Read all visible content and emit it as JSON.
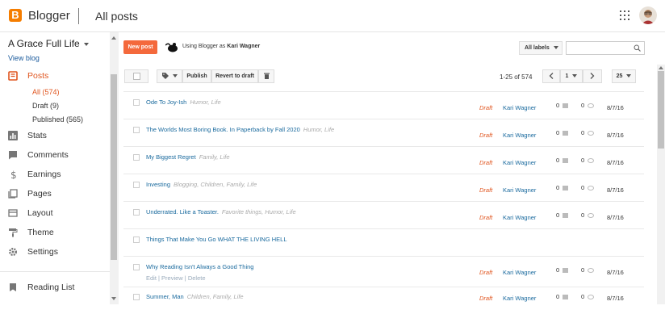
{
  "header": {
    "logo_letter": "B",
    "brand": "Blogger",
    "page_title": "All posts"
  },
  "sidebar": {
    "blog_name": "A Grace Full Life",
    "view_blog": "View blog",
    "posts_label": "Posts",
    "posts_sub": [
      "All (574)",
      "Draft (9)",
      "Published (565)"
    ],
    "items": [
      "Stats",
      "Comments",
      "Earnings",
      "Pages",
      "Layout",
      "Theme",
      "Settings"
    ],
    "reading_list": "Reading List"
  },
  "toolbar": {
    "new_post": "New post",
    "using_as_prefix": "Using Blogger as ",
    "user_name": "Kari Wagner",
    "all_labels": "All labels",
    "publish": "Publish",
    "revert": "Revert to draft",
    "page_info": "1-25 of 574",
    "page_number": "1",
    "page_size": "25"
  },
  "posts": [
    {
      "title": "Ode To Joy-Ish",
      "labels": "Humor, Life",
      "status": "Draft",
      "author": "Kari Wagner",
      "comments": "0",
      "views": "0",
      "date": "8/7/16"
    },
    {
      "title": "The Worlds Most Boring Book. In Paperback by Fall 2020",
      "labels": "Humor, Life",
      "status": "Draft",
      "author": "Kari Wagner",
      "comments": "0",
      "views": "0",
      "date": "8/7/16"
    },
    {
      "title": "My Biggest Regret",
      "labels": "Family, Life",
      "status": "Draft",
      "author": "Kari Wagner",
      "comments": "0",
      "views": "0",
      "date": "8/7/16"
    },
    {
      "title": "Investing",
      "labels": "Blogging, Children, Family, Life",
      "status": "Draft",
      "author": "Kari Wagner",
      "comments": "0",
      "views": "0",
      "date": "8/7/16"
    },
    {
      "title": "Underrated. Like a Toaster.",
      "labels": "Favorite things, Humor, Life",
      "status": "Draft",
      "author": "Kari Wagner",
      "comments": "0",
      "views": "0",
      "date": "8/7/16"
    },
    {
      "title": "Things That Make You Go WHAT THE LIVING HELL",
      "labels": "",
      "status": "Draft",
      "author": "Kari Wagner",
      "comments": "0",
      "views": "0",
      "date": "8/7/16"
    },
    {
      "title": "Why Reading Isn't Always a Good Thing",
      "labels": "",
      "actions": "Edit | Preview | Delete",
      "status": "Draft",
      "author": "Kari Wagner",
      "comments": "0",
      "views": "0",
      "date": "8/7/16"
    },
    {
      "title": "Summer, Man",
      "labels": "Children, Family, Life",
      "status": "Draft",
      "author": "Kari Wagner",
      "comments": "0",
      "views": "0",
      "date": "8/7/16"
    }
  ],
  "colors": {
    "accent": "#f4693c",
    "link": "#1a6a9e",
    "draft": "#e0551f"
  }
}
